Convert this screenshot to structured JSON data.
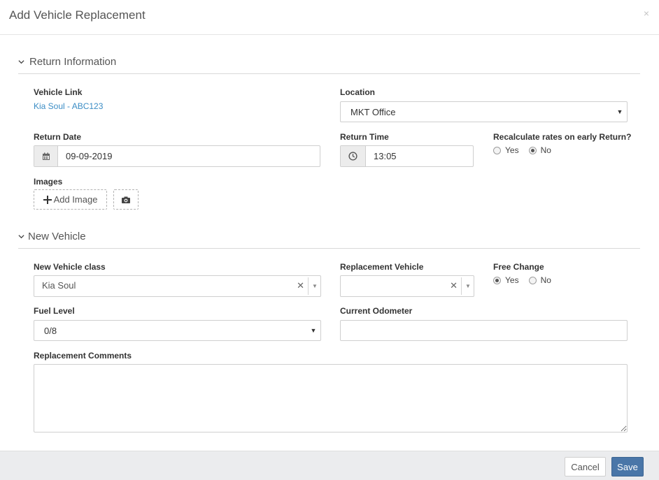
{
  "modal": {
    "title": "Add Vehicle Replacement",
    "close_glyph": "×"
  },
  "return_section": {
    "title": "Return Information",
    "vehicle_link_label": "Vehicle Link",
    "vehicle_link_value": "Kia Soul - ABC123",
    "location_label": "Location",
    "location_value": "MKT Office",
    "return_date_label": "Return Date",
    "return_date_value": "09-09-2019",
    "return_time_label": "Return Time",
    "return_time_value": "13:05",
    "recalc_label": "Recalculate rates on early Return?",
    "recalc_options": [
      "Yes",
      "No"
    ],
    "recalc_selected": "No",
    "images_label": "Images",
    "add_image_label": "Add Image"
  },
  "new_vehicle_section": {
    "title": "New Vehicle",
    "class_label": "New Vehicle class",
    "class_value": "Kia Soul",
    "replacement_label": "Replacement Vehicle",
    "replacement_value": "",
    "free_change_label": "Free Change",
    "free_change_options": [
      "Yes",
      "No"
    ],
    "free_change_selected": "Yes",
    "fuel_label": "Fuel Level",
    "fuel_value": "0/8",
    "odometer_label": "Current Odometer",
    "odometer_value": "",
    "comments_label": "Replacement Comments",
    "comments_value": ""
  },
  "footer": {
    "cancel_label": "Cancel",
    "save_label": "Save"
  },
  "colors": {
    "link": "#3b8dc5",
    "primary": "#4a76a8",
    "footer_bg": "#ebecee"
  }
}
